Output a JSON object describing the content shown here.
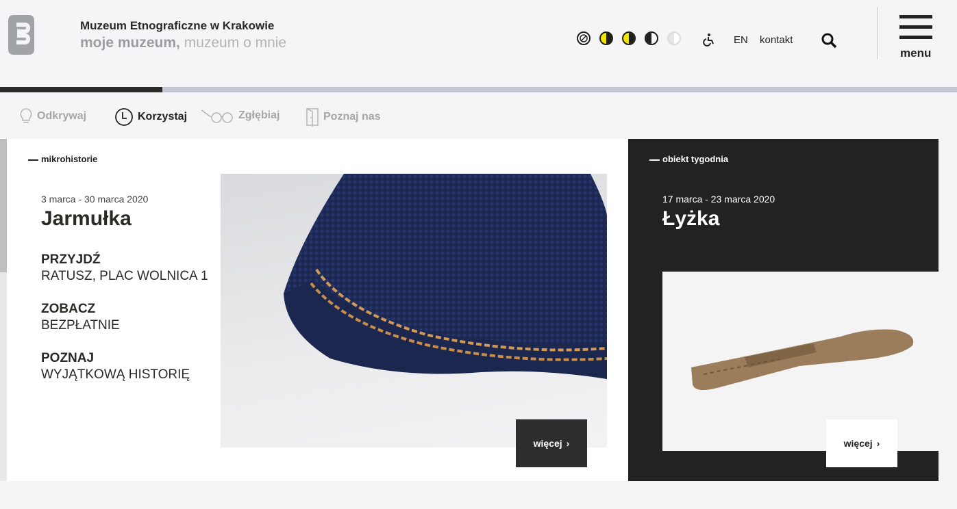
{
  "header": {
    "site_title": "Muzeum Etnograficzne w Krakowie",
    "tagline_bold": "moje muzeum,",
    "tagline_rest": " muzeum o mnie",
    "contrast_options": [
      "contrast-default",
      "contrast-yellow-black",
      "contrast-black-yellow",
      "contrast-black-white",
      "contrast-grey"
    ],
    "accessibility_icon": "wheelchair-icon",
    "language": "EN",
    "contact": "kontakt",
    "search_icon": "search-icon",
    "menu_label": "menu"
  },
  "progress": {
    "value": 0.17
  },
  "nav": {
    "items": [
      {
        "label": "Odkrywaj",
        "icon": "lightbulb-icon",
        "active": false
      },
      {
        "label": "Korzystaj",
        "icon": "clock-icon",
        "active": true
      },
      {
        "label": "Zgłębiaj",
        "icon": "glasses-icon",
        "active": false
      },
      {
        "label": "Poznaj nas",
        "icon": "door-icon",
        "active": false
      }
    ]
  },
  "microhistory": {
    "section_label": "mikrohistorie",
    "date": "3 marca - 30 marca 2020",
    "title": "Jarmułka",
    "info": [
      {
        "head": "PRZYJDŹ",
        "text": "RATUSZ, PLAC WOLNICA 1"
      },
      {
        "head": "ZOBACZ",
        "text": "BEZPŁATNIE"
      },
      {
        "head": "POZNAJ",
        "text": "WYJĄTKOWĄ HISTORIĘ"
      }
    ],
    "more_label": "więcej"
  },
  "object_of_week": {
    "section_label": "obiekt tygodnia",
    "date": "17 marca - 23 marca 2020",
    "title": "Łyżka",
    "more_label": "więcej"
  },
  "colors": {
    "dark": "#222222",
    "accent_yellow": "#f2e600",
    "muted": "#a6a6a9",
    "progress_track": "#c3c7d3"
  }
}
